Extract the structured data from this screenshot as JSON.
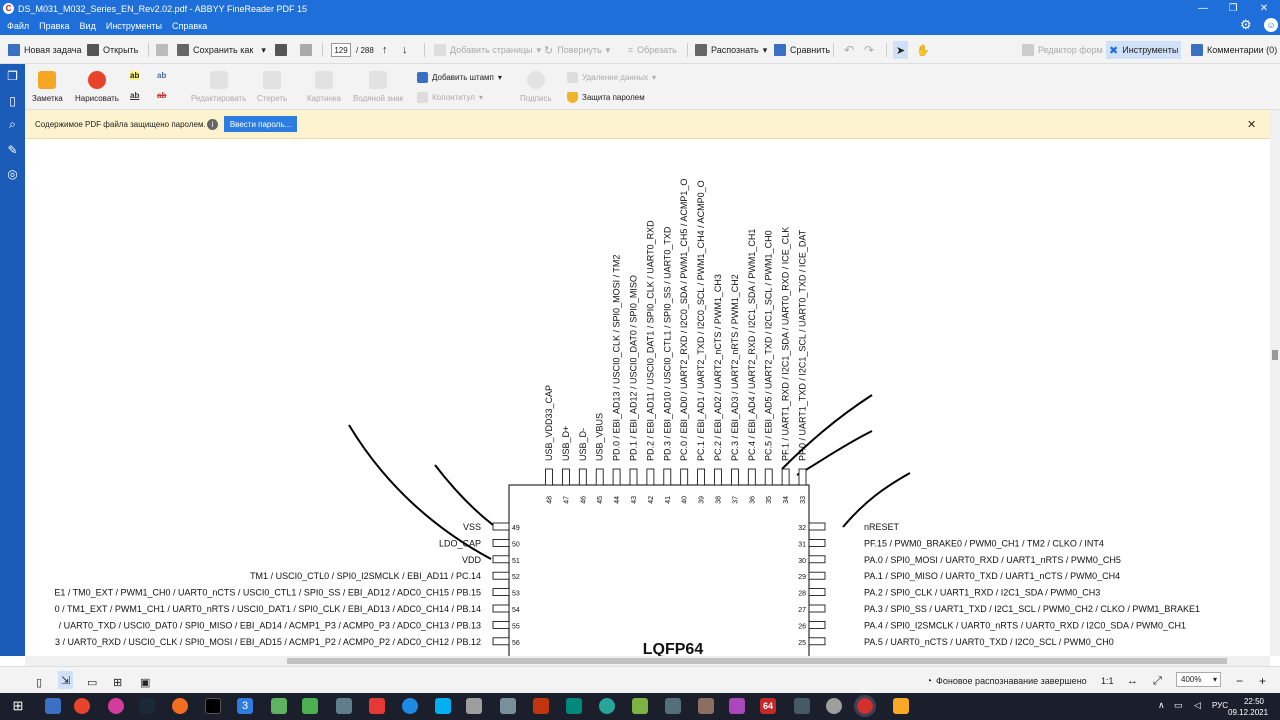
{
  "window": {
    "title": "DS_M031_M032_Series_EN_Rev2.02.pdf - ABBYY FineReader PDF 15",
    "app_glyph": "C",
    "controls": [
      "—",
      "❐",
      "✕"
    ]
  },
  "menu": [
    "Файл",
    "Правка",
    "Вид",
    "Инструменты",
    "Справка"
  ],
  "toolbar": {
    "new_task": "Новая задача",
    "open": "Открыть",
    "save_as": "Сохранить как",
    "page_current": "129",
    "page_total": "/ 288",
    "add_pages": "Добавить страницы",
    "rotate": "Повернуть",
    "crop": "Обрезать",
    "recognize": "Распознать",
    "compare": "Сравнить",
    "form_editor": "Редактор форм",
    "tools": "Инструменты",
    "comments": "Комментарии (0)"
  },
  "ribbon": {
    "note": "Заметка",
    "draw": "Нарисовать",
    "text_marks": [
      "ab",
      "ab",
      "ab",
      "ab"
    ],
    "edit": "Редактировать",
    "erase": "Стереть",
    "picture": "Картинка",
    "watermark": "Водяной знак",
    "add_stamp": "Добавить штамп",
    "header_footer": "Колонтитул",
    "signature": "Подпись",
    "delete_data": "Удаление данных",
    "password_protection": "Защита паролем"
  },
  "notice": {
    "text": "Содержимое PDF файла защищено паролем.",
    "info": "i",
    "button": "Ввести пароль...",
    "close": "✕"
  },
  "chip": {
    "name": "LQFP64",
    "top_pins": [
      {
        "num": "48",
        "label": "USB_VDD33_CAP"
      },
      {
        "num": "47",
        "label": "USB_D+"
      },
      {
        "num": "46",
        "label": "USB_D-"
      },
      {
        "num": "45",
        "label": "USB_VBUS"
      },
      {
        "num": "44",
        "label": "PD.0 / EBI_AD13 / USCI0_CLK / SPI0_MOSI / TM2"
      },
      {
        "num": "43",
        "label": "PD.1 / EBI_AD12 / USCI0_DAT0 / SPI0_MISO"
      },
      {
        "num": "42",
        "label": "PD.2 / EBI_AD11 / USCI0_DAT1 / SPI0_CLK / UART0_RXD"
      },
      {
        "num": "41",
        "label": "PD.3 / EBI_AD10 / USCI0_CTL1 / SPI0_SS / UART0_TXD"
      },
      {
        "num": "40",
        "label": "PC.0 / EBI_AD0 / UART2_RXD / I2C0_SDA / PWM1_CH5 / ACMP1_O"
      },
      {
        "num": "39",
        "label": "PC.1 / EBI_AD1 / UART2_TXD / I2C0_SCL / PWM1_CH4 / ACMP0_O"
      },
      {
        "num": "38",
        "label": "PC.2 / EBI_AD2 / UART2_nCTS / PWM1_CH3"
      },
      {
        "num": "37",
        "label": "PC.3 / EBI_AD3 / UART2_nRTS / PWM1_CH2"
      },
      {
        "num": "36",
        "label": "PC.4 / EBI_AD4 / UART2_RXD / I2C1_SDA / PWM1_CH1"
      },
      {
        "num": "35",
        "label": "PC.5 / EBI_AD5 / UART2_TXD / I2C1_SCL / PWM1_CH0"
      },
      {
        "num": "34",
        "label": "PF.1 / UART1_RXD / I2C1_SDA / UART0_RXD / ICE_CLK"
      },
      {
        "num": "33",
        "label": "PF.0 / UART1_TXD / I2C1_SCL / UART0_TXD / ICE_DAT"
      }
    ],
    "left_pins": [
      {
        "num": "49",
        "label": "VSS"
      },
      {
        "num": "50",
        "label": "LDO_CAP"
      },
      {
        "num": "51",
        "label": "VDD"
      },
      {
        "num": "52",
        "label": "TM1 / USCI0_CTL0 / SPI0_I2SMCLK / EBI_AD11 / PC.14"
      },
      {
        "num": "53",
        "label": "E1 / TM0_EXT / PWM1_CH0 / UART0_nCTS / USCI0_CTL1 / SPI0_SS / EBI_AD12 / ADC0_CH15 / PB.15"
      },
      {
        "num": "54",
        "label": "0 / TM1_EXT / PWM1_CH1 / UART0_nRTS / USCI0_DAT1 / SPI0_CLK / EBI_AD13 / ADC0_CH14 / PB.14"
      },
      {
        "num": "55",
        "label": "/ UART0_TXD / USCI0_DAT0 / SPI0_MISO / EBI_AD14 / ACMP1_P3 / ACMP0_P3 / ADC0_CH13 / PB.13"
      },
      {
        "num": "56",
        "label": "3 / UART0_RXD / USCI0_CLK / SPI0_MOSI / EBI_AD15 / ACMP1_P2 / ACMP0_P2 / ADC0_CH12 / PB.12"
      }
    ],
    "right_pins": [
      {
        "num": "32",
        "label": "nRESET"
      },
      {
        "num": "31",
        "label": "PF.15 / PWM0_BRAKE0 / PWM0_CH1 / TM2 / CLKO / INT4"
      },
      {
        "num": "30",
        "label": "PA.0 / SPI0_MOSI / UART0_RXD / UART1_nRTS / PWM0_CH5"
      },
      {
        "num": "29",
        "label": "PA.1 / SPI0_MISO / UART0_TXD / UART1_nCTS / PWM0_CH4"
      },
      {
        "num": "28",
        "label": "PA.2 / SPI0_CLK / UART1_RXD / I2C1_SDA / PWM0_CH3"
      },
      {
        "num": "27",
        "label": "PA.3 / SPI0_SS / UART1_TXD / I2C1_SCL / PWM0_CH2 / CLKO / PWM1_BRAKE1"
      },
      {
        "num": "26",
        "label": "PA.4 / SPI0_I2SMCLK / UART0_nRTS / UART0_RXD / I2C0_SDA / PWM0_CH1"
      },
      {
        "num": "25",
        "label": "PA.5 / UART0_nCTS / UART0_TXD / I2C0_SCL / PWM0_CH0"
      }
    ]
  },
  "status": {
    "ocr": "Фоновое распознавание завершено",
    "ratio": "1:1",
    "zoom": "400%",
    "zoom_in": "+",
    "zoom_out": "−"
  },
  "taskbar": {
    "time": "22:50",
    "date": "09.12.2021",
    "lang": "РУС",
    "badges": [
      "3",
      "64"
    ]
  }
}
